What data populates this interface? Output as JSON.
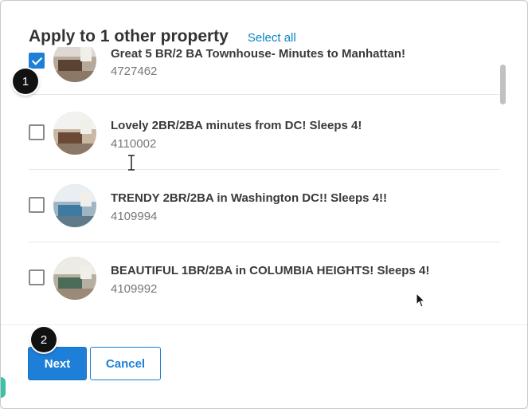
{
  "header": {
    "title": "Apply to 1 other property",
    "select_all": "Select all"
  },
  "properties": [
    {
      "title": "Great 5 BR/2 BA Townhouse- Minutes to Manhattan!",
      "id": "4727462",
      "checked": true
    },
    {
      "title": "Lovely 2BR/2BA minutes from DC! Sleeps 4!",
      "id": "4110002",
      "checked": false
    },
    {
      "title": "TRENDY 2BR/2BA in Washington DC!! Sleeps 4!!",
      "id": "4109994",
      "checked": false
    },
    {
      "title": "BEAUTIFUL 1BR/2BA in COLUMBIA HEIGHTS! Sleeps 4!",
      "id": "4109992",
      "checked": false
    }
  ],
  "footer": {
    "next_label": "Next",
    "cancel_label": "Cancel"
  },
  "annotations": {
    "step1": "1",
    "step2": "2"
  },
  "icons": {
    "checkbox": "check-icon",
    "pointer": "arrow-cursor-icon",
    "text_cursor": "i-beam-cursor-icon"
  },
  "colors": {
    "accent": "#1d7fd8",
    "link": "#0a84c6",
    "badge": "#111111"
  }
}
